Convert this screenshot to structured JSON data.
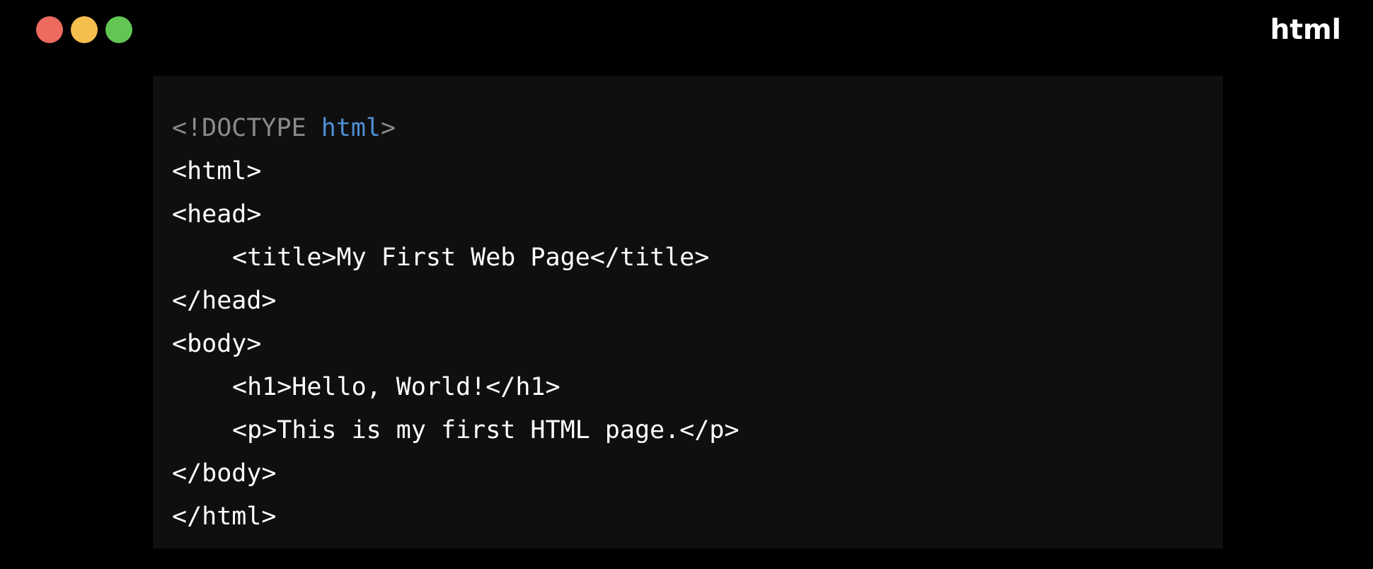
{
  "window": {
    "traffic_lights": [
      {
        "name": "close",
        "color": "#ed6a5e"
      },
      {
        "name": "minimize",
        "color": "#f5bf4f"
      },
      {
        "name": "zoom",
        "color": "#62c554"
      }
    ],
    "language_label": "html"
  },
  "colors": {
    "background": "#000000",
    "panel": "#0f0f0f",
    "text": "#ffffff",
    "doctype": "#8a8a8a",
    "keyword": "#4e8fd4"
  },
  "code": {
    "doctype_open": "<!DOCTYPE ",
    "doctype_keyword": "html",
    "doctype_close": ">",
    "lines": [
      "<html>",
      "<head>",
      "<title>My First Web Page</title>",
      "</head>",
      "<body>",
      "<h1>Hello, World!</h1>",
      "<p>This is my first HTML page.</p>",
      "</body>",
      "</html>"
    ]
  }
}
